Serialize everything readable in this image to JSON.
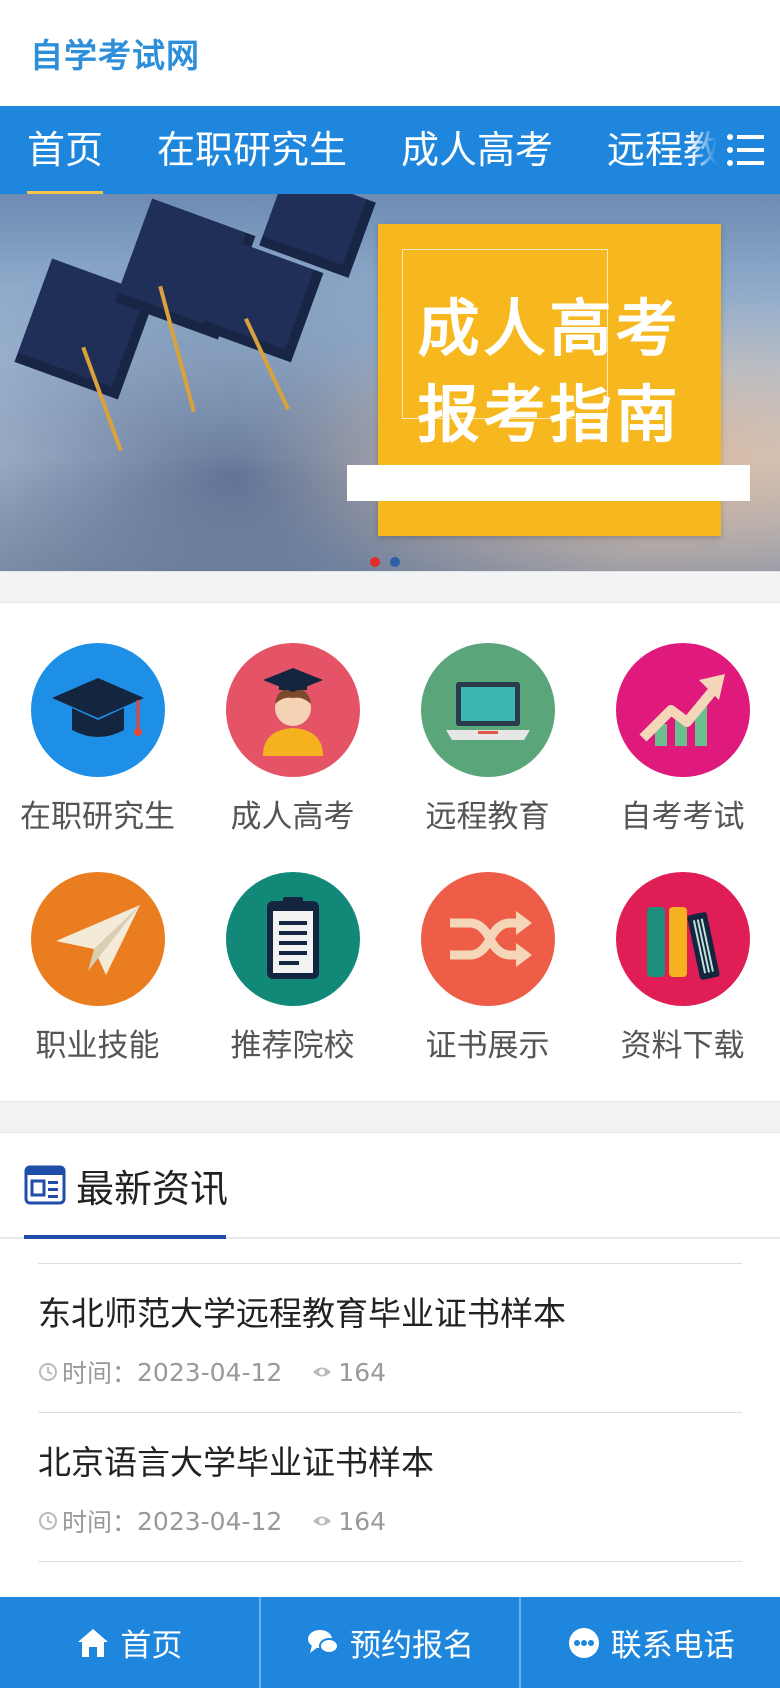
{
  "header": {
    "logo": "自学考试网"
  },
  "nav": {
    "items": [
      {
        "label": "首页",
        "active": true
      },
      {
        "label": "在职研究生",
        "active": false
      },
      {
        "label": "成人高考",
        "active": false
      },
      {
        "label": "远程教育",
        "active": false
      }
    ],
    "menu_icon": "list-icon"
  },
  "banner": {
    "title_line1": "成人高考",
    "title_line2": "报考指南",
    "slide_count": 2,
    "active_slide": 1
  },
  "categories": [
    {
      "label": "在职研究生",
      "icon": "graduation-cap-icon",
      "color": "#1e8fe6"
    },
    {
      "label": "成人高考",
      "icon": "graduate-person-icon",
      "color": "#e45466"
    },
    {
      "label": "远程教育",
      "icon": "laptop-icon",
      "color": "#5aa57a"
    },
    {
      "label": "自考考试",
      "icon": "growth-chart-icon",
      "color": "#e0197d"
    },
    {
      "label": "职业技能",
      "icon": "paper-plane-icon",
      "color": "#ea7d1f"
    },
    {
      "label": "推荐院校",
      "icon": "clipboard-icon",
      "color": "#118878"
    },
    {
      "label": "证书展示",
      "icon": "shuffle-icon",
      "color": "#ee5d47"
    },
    {
      "label": "资料下载",
      "icon": "books-icon",
      "color": "#e01d55"
    }
  ],
  "news": {
    "heading": "最新资讯",
    "items": [
      {
        "title": "东北师范大学远程教育毕业证书样本",
        "time_label": "时间：",
        "date": "2023-04-12",
        "views": "164"
      },
      {
        "title": "北京语言大学毕业证书样本",
        "time_label": "时间：",
        "date": "2023-04-12",
        "views": "164"
      }
    ]
  },
  "bottom_bar": {
    "home": "首页",
    "signup": "预约报名",
    "phone": "联系电话"
  },
  "colors": {
    "primary": "#1e86dc",
    "banner_card": "#f6b81e",
    "news_accent": "#1f4da8"
  }
}
